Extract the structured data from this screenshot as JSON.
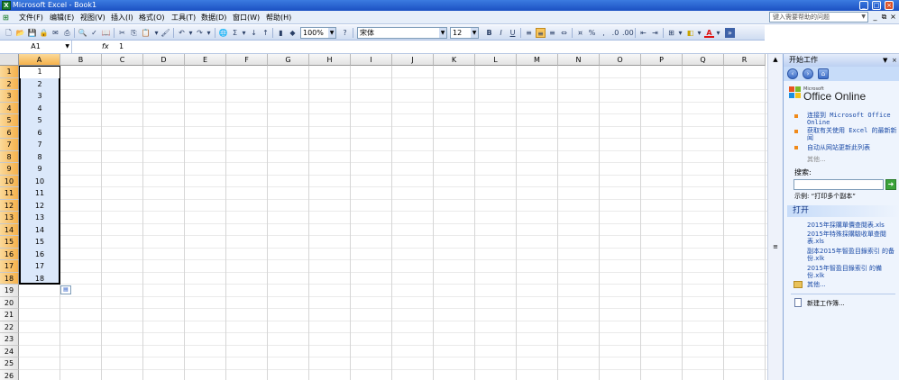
{
  "window": {
    "title": "Microsoft Excel - Book1",
    "app_icon": "X"
  },
  "menu": [
    "文件(F)",
    "编辑(E)",
    "视图(V)",
    "插入(I)",
    "格式(O)",
    "工具(T)",
    "数据(D)",
    "窗口(W)",
    "帮助(H)"
  ],
  "help_box": {
    "placeholder": "键入需要帮助的问题"
  },
  "toolbar": {
    "zoom": "100%",
    "font": "宋体",
    "font_size": "12",
    "bold": "B",
    "italic": "I",
    "underline": "U",
    "percent": "%",
    "sum": "Σ"
  },
  "formula_bar": {
    "name_box": "A1",
    "fx": "fx",
    "value": "1"
  },
  "columns": [
    "A",
    "B",
    "C",
    "D",
    "E",
    "F",
    "G",
    "H",
    "I",
    "J",
    "K",
    "L",
    "M",
    "N",
    "O",
    "P",
    "Q",
    "R"
  ],
  "rows": [
    "1",
    "2",
    "3",
    "4",
    "5",
    "6",
    "7",
    "8",
    "9",
    "10",
    "11",
    "12",
    "13",
    "14",
    "15",
    "16",
    "17",
    "18",
    "19",
    "20",
    "21",
    "22",
    "23",
    "24",
    "25",
    "26"
  ],
  "cells_a": [
    "1",
    "2",
    "3",
    "4",
    "5",
    "6",
    "7",
    "8",
    "9",
    "10",
    "11",
    "12",
    "13",
    "14",
    "15",
    "16",
    "17",
    "18"
  ],
  "task_pane": {
    "title": "开始工作",
    "logo_ms": "Microsoft",
    "logo": "Office Online",
    "links": [
      "连接到 Microsoft Office Online",
      "获取有关使用 Excel 的最新新闻",
      "自动从网站更新此列表"
    ],
    "more1": "其他...",
    "search_label": "搜索:",
    "example": "示例: “打印多个副本”",
    "open_section": "打开",
    "files": [
      "2015年採購單價查閱表.xls",
      "2015年特殊採購驗收單查閱表.xls",
      "副本2015年智盈目錄索引 的备份.xlk",
      "2015年智盈目錄索引 的備份.xlk"
    ],
    "more2": "其他...",
    "new_workbook": "新建工作簿..."
  }
}
